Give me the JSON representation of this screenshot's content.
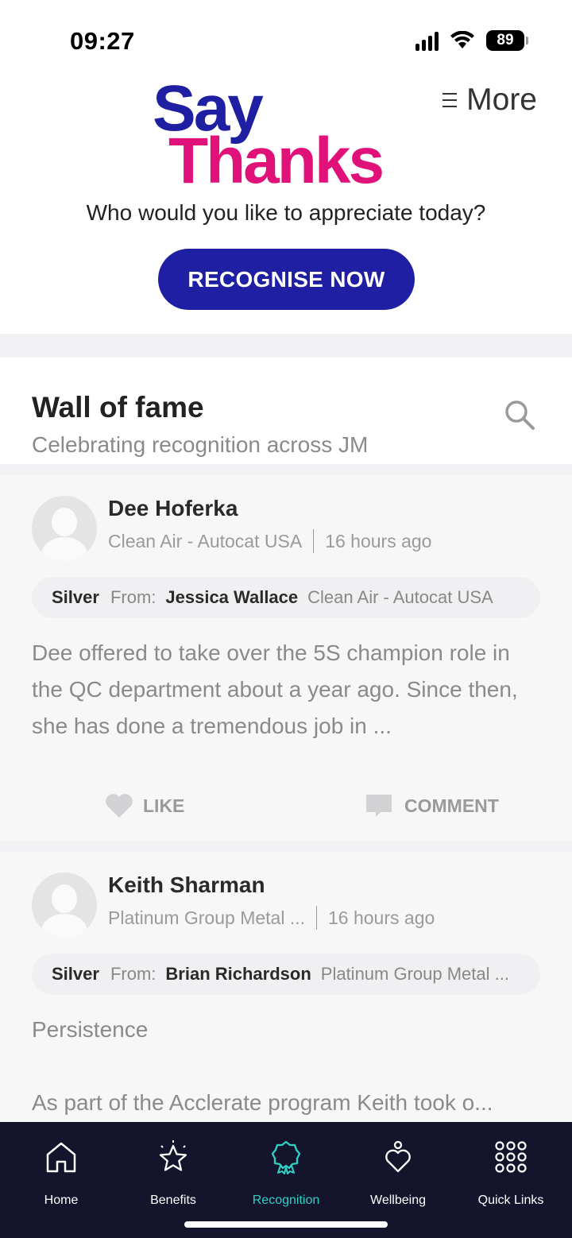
{
  "status_bar": {
    "time": "09:27",
    "battery": "89"
  },
  "header": {
    "logo_line1": "Say",
    "logo_line2": "Thanks",
    "more_label": "More",
    "prompt": "Who would you like to appreciate today?",
    "cta_label": "RECOGNISE NOW"
  },
  "wall": {
    "title": "Wall of fame",
    "subtitle": "Celebrating recognition across JM"
  },
  "posts": [
    {
      "name": "Dee Hoferka",
      "department": "Clean Air - Autocat USA",
      "time": "16 hours ago",
      "level": "Silver",
      "from_label": "From:",
      "from_name": "Jessica Wallace",
      "from_department": "Clean Air - Autocat USA",
      "message": "Dee offered to take over the 5S champion role in the QC department about a year ago. Since then, she has done a tremendous job in ...",
      "like_label": "LIKE",
      "comment_label": "COMMENT"
    },
    {
      "name": "Keith Sharman",
      "department": "Platinum Group Metal ...",
      "time": "16 hours ago",
      "level": "Silver",
      "from_label": "From:",
      "from_name": "Brian Richardson",
      "from_department": "Platinum Group Metal ...",
      "message_title": "Persistence",
      "message": "As part of the Acclerate program Keith took o..."
    }
  ],
  "nav": {
    "items": [
      {
        "label": "Home",
        "icon": "home-icon"
      },
      {
        "label": "Benefits",
        "icon": "star-icon"
      },
      {
        "label": "Recognition",
        "icon": "award-icon"
      },
      {
        "label": "Wellbeing",
        "icon": "heart-icon"
      },
      {
        "label": "Quick Links",
        "icon": "grid-icon"
      }
    ],
    "active": "Recognition"
  },
  "colors": {
    "brand_blue": "#1f1fa3",
    "brand_pink": "#e0127a",
    "nav_bg": "#14142d",
    "nav_active": "#2fd1c5"
  }
}
